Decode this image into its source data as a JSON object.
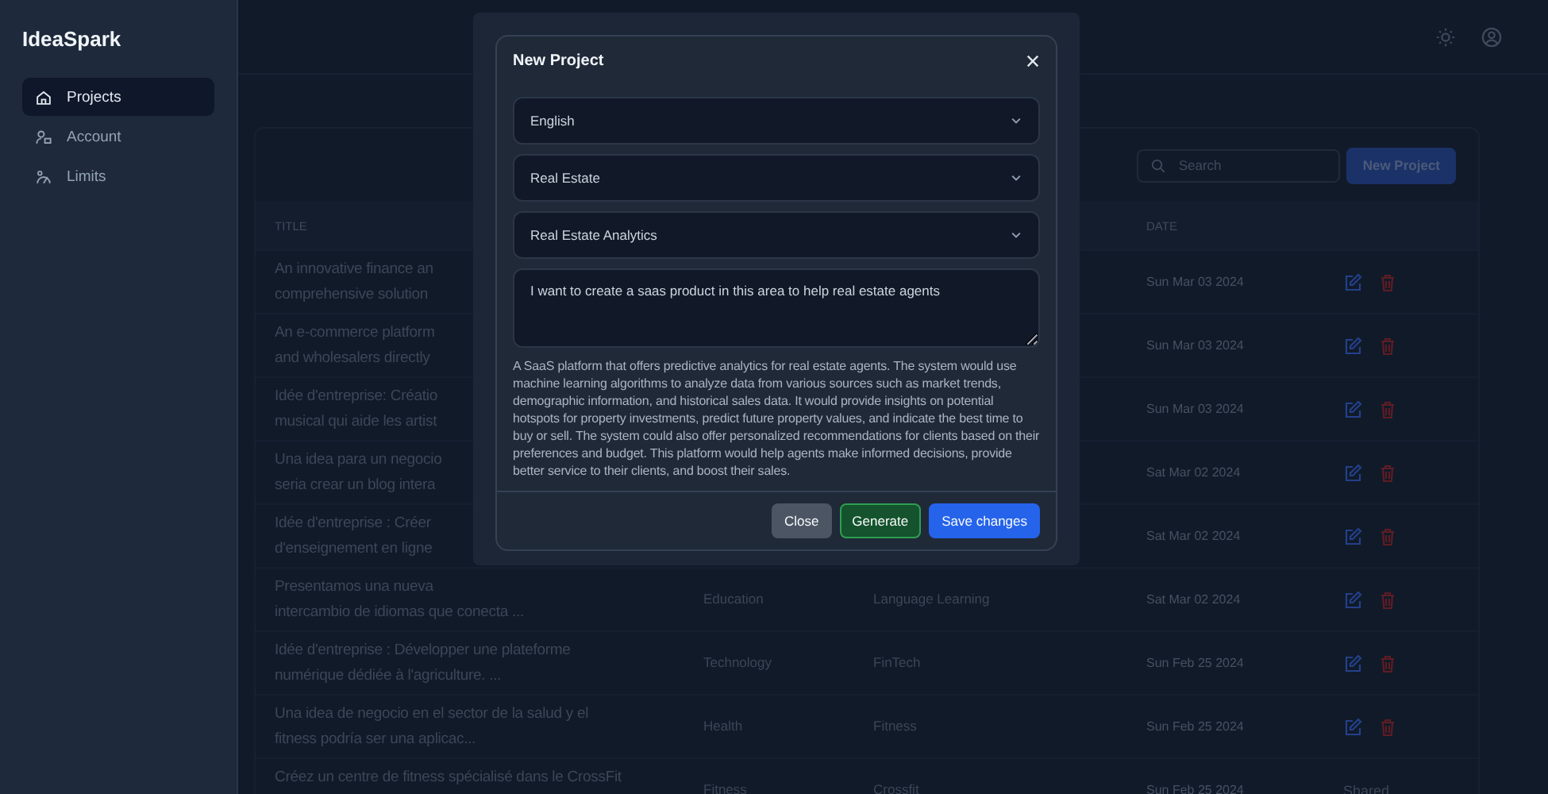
{
  "app": {
    "name": "IdeaSpark"
  },
  "sidebar": {
    "items": [
      {
        "label": "Projects",
        "selected": true
      },
      {
        "label": "Account",
        "selected": false
      },
      {
        "label": "Limits",
        "selected": false
      }
    ]
  },
  "toolbar": {
    "search": {
      "placeholder": "Search"
    },
    "button": "New Project"
  },
  "table": {
    "columns": {
      "title": "TITLE",
      "date": "DATE"
    },
    "rows": [
      {
        "title": [
          "An innovative finance an",
          "comprehensive solution"
        ],
        "date": "Sun Mar 03 2024"
      },
      {
        "title": [
          "An e-commerce platform",
          "and wholesalers directly"
        ],
        "date": "Sun Mar 03 2024"
      },
      {
        "title": [
          "Idée d'entreprise: Créatio",
          "musical qui aide les artist"
        ],
        "date": "Sun Mar 03 2024"
      },
      {
        "title": [
          "Una idea para un negocio",
          "seria crear un blog intera"
        ],
        "date": "Sat Mar 02 2024"
      },
      {
        "title": [
          "Idée d'entreprise : Créer",
          "d'enseignement en ligne"
        ],
        "date": "Sat Mar 02 2024"
      },
      {
        "title": [
          "Presentamos una nueva",
          "intercambio de idiomas que conecta ..."
        ],
        "category": "Education",
        "subcategory": "Language Learning",
        "date": "Sat Mar 02 2024"
      },
      {
        "title": [
          "Idée d'entreprise : Développer une plateforme",
          "numérique dédiée à l'agriculture. ..."
        ],
        "category": "Technology",
        "subcategory": "FinTech",
        "date": "Sun Feb 25 2024"
      },
      {
        "title": [
          "Una idea de negocio en el sector de la salud y el",
          "fitness podría ser una aplicac..."
        ],
        "category": "Health",
        "subcategory": "Fitness",
        "date": "Sun Feb 25 2024"
      },
      {
        "title": [
          "Créez un centre de fitness spécialisé dans le CrossFit"
        ],
        "category": "Fitness",
        "subcategory": "Crossfit",
        "date": "Sun Feb 25 2024",
        "status": "Shared"
      }
    ]
  },
  "modal": {
    "title": "New Project",
    "selects": [
      "English",
      "Real Estate",
      "Real Estate Analytics"
    ],
    "prompt": "I want to create a saas product in this area to help real estate agents",
    "result": "A SaaS platform that offers predictive analytics for real estate agents. The system would use machine learning algorithms to analyze data from various sources such as market trends, demographic information, and historical sales data. It would provide insights on potential hotspots for property investments, predict future property values, and indicate the best time to buy or sell. The system could also offer personalized recommendations for clients based on their preferences and budget. This platform would help agents make informed decisions, provide better service to their clients, and boost their sales.",
    "buttons": [
      {
        "label": "Close",
        "kind": "secondary"
      },
      {
        "label": "Generate",
        "kind": "success"
      },
      {
        "label": "Save changes",
        "kind": "primary"
      }
    ]
  }
}
